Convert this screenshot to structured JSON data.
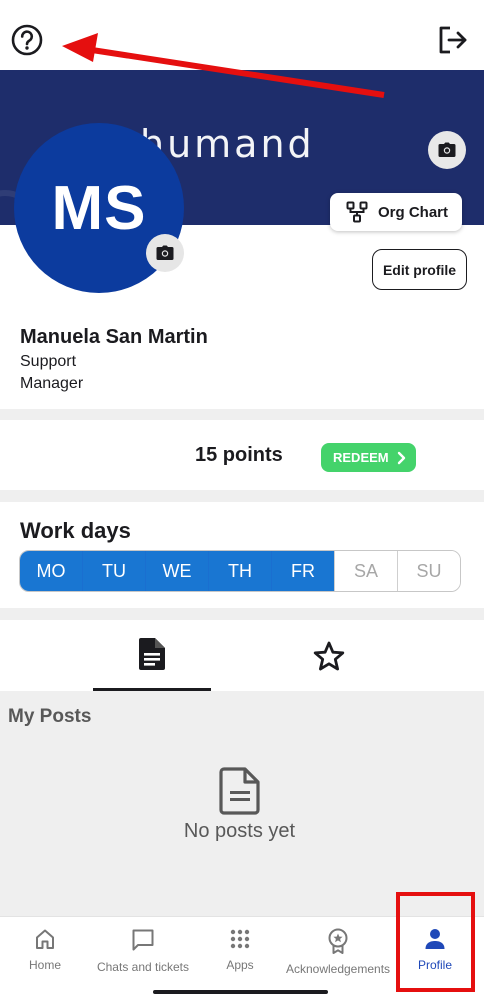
{
  "header": {
    "help_icon": "help-circle-icon",
    "logout_icon": "logout-icon"
  },
  "cover": {
    "logo_text": "humand",
    "background_color": "#1e2d6b",
    "camera_icon": "camera-icon"
  },
  "profile": {
    "initials": "MS",
    "avatar_color": "#0c3b9e",
    "name": "Manuela San Martin",
    "role_line1": "Support",
    "role_line2": "Manager",
    "org_chart_label": "Org Chart",
    "edit_profile_label": "Edit profile"
  },
  "points": {
    "text": "15 points",
    "redeem_label": "REDEEM",
    "redeem_color": "#44d36b"
  },
  "work_days": {
    "title": "Work days",
    "days": [
      {
        "label": "MO",
        "active": true
      },
      {
        "label": "TU",
        "active": true
      },
      {
        "label": "WE",
        "active": true
      },
      {
        "label": "TH",
        "active": true
      },
      {
        "label": "FR",
        "active": true
      },
      {
        "label": "SA",
        "active": false
      },
      {
        "label": "SU",
        "active": false
      }
    ],
    "active_color": "#1976d2"
  },
  "tabs": [
    {
      "icon": "document-icon",
      "selected": true
    },
    {
      "icon": "star-icon",
      "selected": false
    }
  ],
  "posts": {
    "title": "My Posts",
    "empty_text": "No posts yet"
  },
  "nav": {
    "items": [
      {
        "label": "Home",
        "icon": "home-icon"
      },
      {
        "label": "Chats and tickets",
        "icon": "chat-icon"
      },
      {
        "label": "Apps",
        "icon": "apps-grid-icon"
      },
      {
        "label": "Acknowledgements",
        "icon": "award-icon"
      },
      {
        "label": "Profile",
        "icon": "person-icon"
      }
    ],
    "active_color": "#1f48b8"
  }
}
